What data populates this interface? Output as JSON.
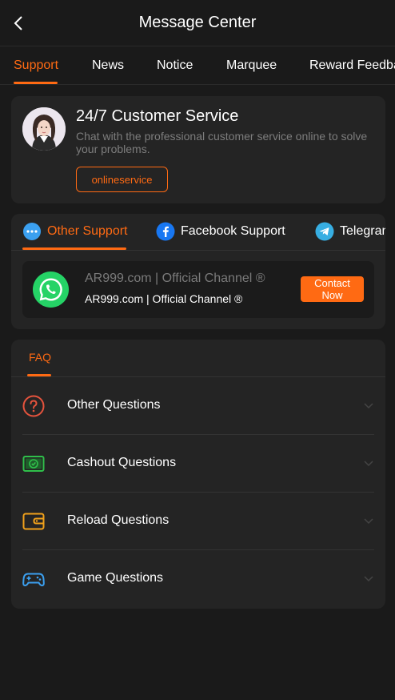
{
  "header": {
    "title": "Message Center"
  },
  "tabs": [
    {
      "label": "Support",
      "active": true
    },
    {
      "label": "News"
    },
    {
      "label": "Notice"
    },
    {
      "label": "Marquee"
    },
    {
      "label": "Reward Feedback"
    }
  ],
  "customer_service": {
    "title": "24/7 Customer Service",
    "description": "Chat with the professional customer service online to solve your problems.",
    "button_label": "onlineservice"
  },
  "support": {
    "tabs": [
      {
        "label": "Other Support",
        "icon": "chat-bubble-icon",
        "active": true
      },
      {
        "label": "Facebook Support",
        "icon": "facebook-icon"
      },
      {
        "label": "Telegram",
        "icon": "telegram-icon"
      }
    ],
    "channel": {
      "name": "AR999.com | Official Channel ®",
      "subtitle": "AR999.com | Official Channel ®",
      "icon": "whatsapp-icon",
      "button_label": "Contact Now"
    }
  },
  "faq": {
    "tab_label": "FAQ",
    "items": [
      {
        "label": "Other Questions",
        "icon": "question-circle-icon"
      },
      {
        "label": "Cashout Questions",
        "icon": "cash-icon"
      },
      {
        "label": "Reload Questions",
        "icon": "wallet-icon"
      },
      {
        "label": "Game Questions",
        "icon": "gamepad-icon"
      }
    ]
  },
  "colors": {
    "accent": "#ff6a13",
    "background": "#1a1a1a",
    "card": "#242424",
    "muted_text": "#7d7d7d"
  }
}
